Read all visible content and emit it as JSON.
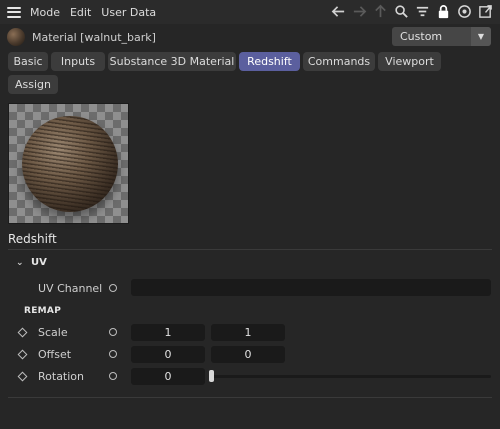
{
  "menu": {
    "items": [
      "Mode",
      "Edit",
      "User Data"
    ]
  },
  "toolbar": {
    "icons": [
      "arrow-left-icon",
      "arrow-right-icon",
      "arrow-up-icon",
      "search-icon",
      "filter-icon",
      "lock-icon",
      "target-icon",
      "new-window-icon"
    ]
  },
  "material": {
    "title": "Material [walnut_bark]",
    "layout_select": "Custom"
  },
  "tabs": [
    {
      "label": "Basic",
      "active": false
    },
    {
      "label": "Inputs",
      "active": false
    },
    {
      "label": "Substance 3D Material",
      "active": false
    },
    {
      "label": "Redshift",
      "active": true
    },
    {
      "label": "Commands",
      "active": false
    },
    {
      "label": "Viewport",
      "active": false
    },
    {
      "label": "Assign",
      "active": false
    }
  ],
  "section": {
    "title": "Redshift"
  },
  "uv": {
    "header": "UV",
    "channel_label": "UV Channel",
    "channel_value": ""
  },
  "remap": {
    "header": "REMAP",
    "scale_label": "Scale",
    "scale_x": "1",
    "scale_y": "1",
    "offset_label": "Offset",
    "offset_x": "0",
    "offset_y": "0",
    "rotation_label": "Rotation",
    "rotation_value": "0",
    "rotation_slider_fraction": 0.0
  },
  "colors": {
    "active_tab": "#5b5f9e",
    "background": "#262626",
    "field": "#1a1a1a"
  }
}
